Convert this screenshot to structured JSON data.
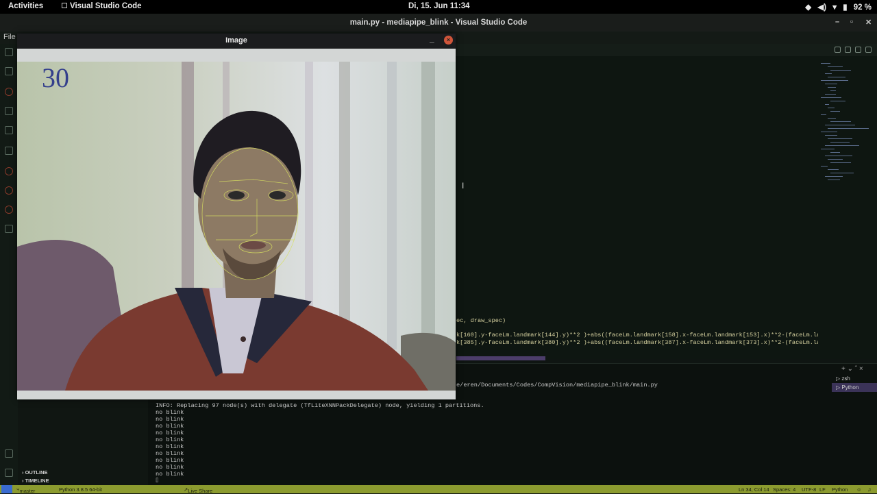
{
  "topbar": {
    "activities": "Activities",
    "app_name": "Visual Studio Code",
    "clock": "Di, 15. Jun  11:34",
    "battery": "92 %"
  },
  "window": {
    "title": "main.py - mediapipe_blink - Visual Studio Code",
    "menu_file": "File"
  },
  "editor": {
    "lines": [
      "ec, draw_spec)",
      "k[160].y-faceLm.landmark[144].y)**2 )+abs((faceLm.landmark[158].x-faceLm.landmark[153].x)**2-(faceLm.landmark[15",
      "k[385].y-faceLm.landmark[380].y)**2 )+abs((faceLm.landmark[387].x-faceLm.landmark[373].x)**2-(faceLm.landmark[38"
    ]
  },
  "terminal": {
    "path_line": "e/eren/Documents/Codes/CompVision/mediapipe_blink/main.py",
    "info_line": "INFO: Replacing 97 node(s) with delegate (TfLiteXNNPackDelegate) node, yielding 1 partitions.",
    "output": [
      "no blink",
      "no blink",
      "no blink",
      "no blink",
      "no blink",
      "no blink",
      "no blink",
      "no blink",
      "no blink",
      "no blink"
    ],
    "shells": [
      "zsh",
      "Python"
    ]
  },
  "sidebar": {
    "outline": "OUTLINE",
    "timeline": "TIMELINE"
  },
  "statusbar": {
    "branch": "master",
    "python": "Python 3.8.5 64-bit",
    "liveshare": "Live Share",
    "position": "Ln 34, Col 14",
    "spaces": "Spaces: 4",
    "encoding": "UTF-8",
    "eol": "LF",
    "language": "Python"
  },
  "cv_window": {
    "title": "Image",
    "fps": "30"
  },
  "colors": {
    "status_bar": "#8c9b2f",
    "fps_text": "#343f8c",
    "face_mesh": "#d8e060",
    "close_button": "#d0553a"
  }
}
